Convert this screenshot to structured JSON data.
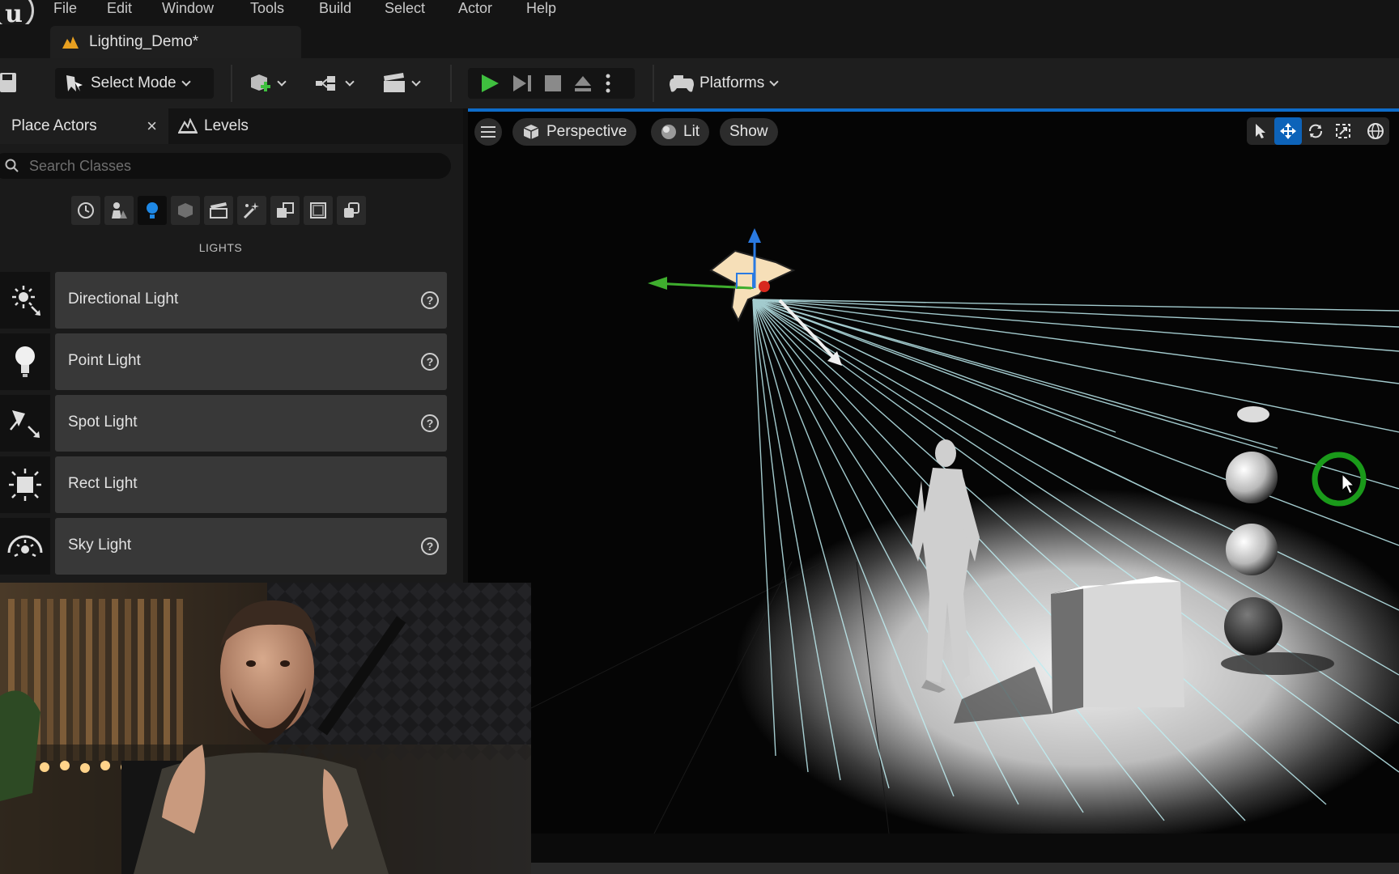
{
  "menu": {
    "items": [
      "File",
      "Edit",
      "Window",
      "Tools",
      "Build",
      "Select",
      "Actor",
      "Help"
    ]
  },
  "tab": {
    "level_name": "Lighting_Demo*"
  },
  "toolbar": {
    "select_mode_label": "Select Mode",
    "platforms_label": "Platforms"
  },
  "panel": {
    "tabs": {
      "place_actors": "Place Actors",
      "levels": "Levels"
    },
    "close_glyph": "×",
    "search_placeholder": "Search Classes",
    "section_title": "LIGHTS",
    "categories": [
      "recent-icon",
      "basic-icon",
      "lights-icon",
      "shapes-icon",
      "cinematic-icon",
      "visual-effects-icon",
      "volumes-icon",
      "geometry-icon",
      "all-classes-icon"
    ],
    "actors": [
      {
        "label": "Directional Light",
        "icon": "directional-light-icon",
        "help": true
      },
      {
        "label": "Point Light",
        "icon": "point-light-icon",
        "help": true
      },
      {
        "label": "Spot Light",
        "icon": "spot-light-icon",
        "help": true
      },
      {
        "label": "Rect Light",
        "icon": "rect-light-icon",
        "help": false
      },
      {
        "label": "Sky Light",
        "icon": "sky-light-icon",
        "help": true
      }
    ]
  },
  "viewport": {
    "perspective_label": "Perspective",
    "lit_label": "Lit",
    "show_label": "Show"
  },
  "colors": {
    "accent_blue": "#0e6cc9",
    "play_green": "#3fbf3f",
    "light_rays": "#bfeef2",
    "cursor_ring": "#1a9a1a"
  }
}
